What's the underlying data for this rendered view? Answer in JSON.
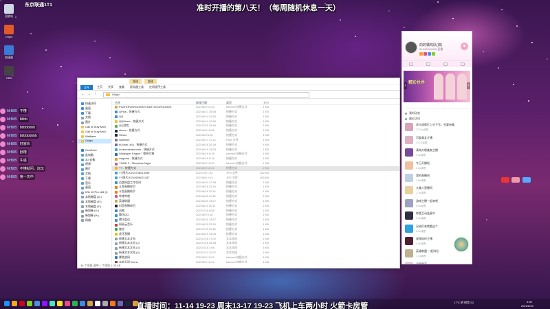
{
  "overlay": {
    "stream_title": "准时开播的第八天！（每周随机休息一天）",
    "stream_schedule": "直播时间：11-14 19-23 周末13-17 19-23 飞机上车两小时 火箭卡房管",
    "brand": "东京联通1T1"
  },
  "desktop_icons": [
    {
      "label": "回收站",
      "icon": "recycle-bin-icon",
      "color": "#cfd8e6"
    },
    {
      "label": "Origin",
      "icon": "origin-icon",
      "color": "#e05a2b"
    },
    {
      "label": "加速器",
      "icon": "accelerator-icon",
      "color": "#3a7bd5"
    },
    {
      "label": "OBS",
      "icon": "obs-icon",
      "color": "#444"
    }
  ],
  "chat": [
    {
      "user": "MrB85",
      "msg": "不懂"
    },
    {
      "user": "MrB85",
      "msg": "bbbb"
    },
    {
      "user": "MrB85",
      "msg": "bbbbbbbb"
    },
    {
      "user": "MrB85",
      "msg": "bbbbbbbbb"
    },
    {
      "user": "MrB85",
      "msg": "好家伙"
    },
    {
      "user": "MrB85",
      "msg": "卧槽"
    },
    {
      "user": "MrB85",
      "msg": "牛逼"
    },
    {
      "user": "MrB85",
      "msg": "不懂就问，这玩"
    },
    {
      "user": "MrB85",
      "msg": "第一次中"
    }
  ],
  "explorer": {
    "title_tabs": [
      "管理",
      "管理"
    ],
    "ribbon_tabs": [
      "文件",
      "主页",
      "共享",
      "查看",
      "驱动器工具",
      "应用程序工具"
    ],
    "address": "Origin",
    "columns": {
      "name": "名称",
      "date": "修改日期",
      "type": "类型",
      "size": "大小"
    },
    "nav": [
      {
        "label": "快速访问",
        "color": "#3d8fe0"
      },
      {
        "label": "桌面",
        "color": "#3d8fe0"
      },
      {
        "label": "下载",
        "color": "#3d8fe0"
      },
      {
        "label": "文档",
        "color": "#8aa0b8"
      },
      {
        "label": "图片",
        "color": "#8aa0b8"
      },
      {
        "label": "Call of Duty  Mod",
        "color": "#f2c24b"
      },
      {
        "label": "Call of Duty  Mod",
        "color": "#f2c24b"
      },
      {
        "label": "Wallhere",
        "color": "#f2c24b"
      },
      {
        "label": "Origin",
        "color": "#f2c24b"
      },
      {
        "label": "",
        "color": "transparent"
      },
      {
        "label": "OneDrive",
        "color": "#2f7fd8"
      },
      {
        "label": "此电脑",
        "color": "#5aa0e0"
      },
      {
        "label": "3D 对象",
        "color": "#5aa0e0"
      },
      {
        "label": "视频",
        "color": "#5aa0e0"
      },
      {
        "label": "图片",
        "color": "#5aa0e0"
      },
      {
        "label": "文档",
        "color": "#5aa0e0"
      },
      {
        "label": "下载",
        "color": "#5aa0e0"
      },
      {
        "label": "音乐",
        "color": "#5aa0e0"
      },
      {
        "label": "桌面",
        "color": "#5aa0e0"
      },
      {
        "label": "Win 10 Pro x64 (C",
        "color": "#8aa0b8"
      },
      {
        "label": "本地磁盘 (D:)",
        "color": "#8aa0b8"
      },
      {
        "label": "本地磁盘 (E:)",
        "color": "#8aa0b8"
      },
      {
        "label": "本地磁盘 (F:)",
        "color": "#8aa0b8"
      },
      {
        "label": "新加卷 (G:)",
        "color": "#8aa0b8"
      },
      {
        "label": "新加卷 (H:)",
        "color": "#8aa0b8"
      },
      {
        "label": "网络",
        "color": "#8aa0b8"
      }
    ],
    "files": [
      {
        "name": "PLAYERUNKNOWN'S BATTLEGROUNDS",
        "date": "2021/6/9 15:24",
        "type": "Internet 快捷方式",
        "size": "1 KB",
        "color": "#d9a33a"
      },
      {
        "name": "QPlus - 快捷方式",
        "date": "2021/6/17 19:08",
        "type": "快捷方式",
        "size": "1 KB",
        "color": "#3a8fd9"
      },
      {
        "name": "QQ",
        "date": "2021/6/14 10:18",
        "type": "快捷方式",
        "size": "1 KB",
        "color": "#3a8fd9"
      },
      {
        "name": "QQMusic - 快捷方式",
        "date": "2021/6/14 10:18",
        "type": "快捷方式",
        "size": "1 KB",
        "color": "#f1c232"
      },
      {
        "name": "QQ游戏",
        "date": "2021/7/21 19:45",
        "type": "快捷方式",
        "size": "1 KB",
        "color": "#5ab04a"
      },
      {
        "name": "steam - 快捷方式",
        "date": "2021/4/9 18:08",
        "type": "快捷方式",
        "size": "1 KB",
        "color": "#1b2838"
      },
      {
        "name": "Steam",
        "date": "2021/6/9 8:16",
        "type": "快捷方式",
        "size": "1 KB",
        "color": "#1b2838"
      },
      {
        "name": "Wallhere",
        "date": "2021/4/17 17:41",
        "type": "PNG 文件",
        "size": "1 KB",
        "color": "#7a7a7a"
      },
      {
        "name": "tx2dark_x64 - 快捷方式",
        "date": "2021/6/16 20:28",
        "type": "快捷方式",
        "size": "1 KB",
        "color": "#6a6aaa"
      },
      {
        "name": "uuremotelauncher - 快捷方式",
        "date": "2021/6/19 13:05",
        "type": "快捷方式",
        "size": "1 KB",
        "color": "#4aa3df"
      },
      {
        "name": "Wallpaper Engine：壁纸引擎",
        "date": "2021/6/19 8:18",
        "type": "Internet 快捷方式",
        "size": "1 KB",
        "color": "#2a66b8"
      },
      {
        "name": "wegame - 快捷方式",
        "date": "2021/6/19 0:18",
        "type": "快捷方式",
        "size": "1 KB",
        "color": "#e0a030"
      },
      {
        "name": "YUME 2 - Sleepless Night",
        "date": "2021/6/9 15:24",
        "type": "Internet 快捷方式",
        "size": "1 KB",
        "color": "#c05aa0"
      },
      {
        "name": "YY - 快捷方式",
        "date": "2021/6/9 15:11",
        "type": "快捷方式",
        "size": "2 KB",
        "color": "#f2b600",
        "selected": true
      },
      {
        "name": "YY图片20210708013449",
        "date": "2021/7/8 1:34",
        "type": "JPG 文件",
        "size": "342 KB",
        "color": "#3aa0e0"
      },
      {
        "name": "YY图片20210606021437",
        "date": "2021/6/6 2:14",
        "type": "JPG 文件",
        "size": "193 KB",
        "color": "#3aa0e0"
      },
      {
        "name": "百度网盘工作空间",
        "date": "2021/6/10 17:38",
        "type": "快捷方式",
        "size": "1 KB",
        "color": "#3a8fd9"
      },
      {
        "name": "斗鱼直播伴侣",
        "date": "2021/6/15 22:19",
        "type": "快捷方式",
        "size": "1 KB",
        "color": "#f07a1a"
      },
      {
        "name": "斗鱼直播助手",
        "date": "2021/6/15 22:41",
        "type": "快捷方式",
        "size": "1 KB",
        "color": "#f07a1a"
      },
      {
        "name": "哔哩哔哩",
        "date": "2021/6/22 11:45",
        "type": "快捷方式",
        "size": "1 KB",
        "color": "#e84a8a"
      },
      {
        "name": "英雄联盟",
        "date": "2021/6/20 13:07",
        "type": "快捷方式",
        "size": "1 KB",
        "color": "#c9a84a"
      },
      {
        "name": "抖音直播伴侣",
        "date": "2021/6/10 20:11",
        "type": "快捷方式",
        "size": "1 KB",
        "color": "#222"
      },
      {
        "name": "迅雷",
        "date": "2021/7/18 8:58",
        "type": "快捷方式",
        "size": "1 KB",
        "color": "#3a7fe0"
      },
      {
        "name": "腾讯QQ",
        "date": "2021/6/9 0:18",
        "type": "快捷方式",
        "size": "1 KB",
        "color": "#3a8fd9"
      },
      {
        "name": "腾讯会议",
        "date": "2021/6/21 13:07",
        "type": "快捷方式",
        "size": "1 KB",
        "color": "#3a8fd9"
      },
      {
        "name": "网易云音乐",
        "date": "2021/6/15 22:19",
        "type": "快捷方式",
        "size": "1 KB",
        "color": "#d33a3a"
      },
      {
        "name": "微信",
        "date": "2021/7/11 21:38",
        "type": "快捷方式",
        "size": "1 KB",
        "color": "#2bb24c"
      },
      {
        "name": "虎牙直播",
        "date": "2021/6/19 13:03",
        "type": "快捷方式",
        "size": "1 KB",
        "color": "#f2b600"
      },
      {
        "name": "新建文本文档",
        "date": "2021/7/18 17:02",
        "type": "文本文档",
        "size": "1 KB",
        "color": "#8aa0b8"
      },
      {
        "name": "新建文本文档 (2)",
        "date": "2021/7/18 16:38",
        "type": "文本文档",
        "size": "1 KB",
        "color": "#8aa0b8"
      },
      {
        "name": "新建文本文档 (3)",
        "date": "2021/7/15 1:08",
        "type": "文本文档",
        "size": "1 KB",
        "color": "#8aa0b8"
      },
      {
        "name": "新建文本文档 (4)",
        "date": "2021/7/12 10:37",
        "type": "文本文档",
        "size": "1 KB",
        "color": "#8aa0b8"
      },
      {
        "name": "暴雪战网",
        "date": "2021/6/9 15:24",
        "type": "Internet 快捷方式",
        "size": "1 KB",
        "color": "#2a7fd0"
      },
      {
        "name": "永劫无间 Demo",
        "date": "2021/6/9 15:24",
        "type": "Internet 快捷方式",
        "size": "1 KB",
        "color": "#a03a3a"
      },
      {
        "name": "永劫无间",
        "date": "2021/7/8 8:22",
        "type": "快捷方式",
        "size": "1 KB",
        "color": "#a03a3a"
      },
      {
        "name": "原神",
        "date": "2021/7/28 0:09",
        "type": "快捷方式",
        "size": "1 KB",
        "color": "#7ab0e0"
      }
    ],
    "status": "36 个项目   选中 1 个项目  1.33 KB"
  },
  "panel": {
    "name": "的的橘鸡队(双)",
    "sub": "ID:990240945 直播",
    "banner_text": "精彩世界",
    "section_rows": [
      "我的动态",
      "最近访问"
    ],
    "feed": [
      {
        "title": "求大佬帮忙上分下号，先要有事",
        "meta": "273.6w观看",
        "color": "#d9a3b8"
      },
      {
        "title": "可爱美女主播",
        "meta": "12.1w观看",
        "color": "#e0b0c0"
      },
      {
        "title": "清纯大眼美女主播",
        "meta": "9.3w观看",
        "color": "#7a4a9a"
      },
      {
        "title": "今日开播啦",
        "meta": "5.2w观看",
        "color": "#f0c0a0"
      },
      {
        "title": "我的直播间",
        "meta": "2.8w观看",
        "color": "#c0d0e0"
      },
      {
        "title": "大美人直播间",
        "meta": "1.7w观看",
        "color": "#e8d0a0"
      },
      {
        "title": "游戏主播一起来吧",
        "meta": "8.4w观看",
        "color": "#a0a0c0"
      },
      {
        "title": "惊喜互动连麦中",
        "meta": "3.6w观看",
        "color": "#303040"
      },
      {
        "title": "兄弟们来看看这个",
        "meta": "6.1w观看",
        "color": "#30a0e0"
      },
      {
        "title": "深夜陪伴主播",
        "meta": "4.9w观看",
        "color": "#502030"
      },
      {
        "title": "英雄联盟 一起排位",
        "meta": "7.7w观看",
        "color": "#c0b090"
      },
      {
        "title": "温暖歌声",
        "meta": "2.2w观看",
        "color": "#e0c0d0"
      }
    ]
  },
  "taskbar": {
    "tray_text": "17°C 阴  拼音 S2",
    "clock_time": "4:55",
    "clock_date": "2021/8/20",
    "icons": [
      "#1e90ff",
      "#f5a623",
      "#d0021b",
      "#7ed321",
      "#4a90e2",
      "#9013fe",
      "#50e3c2",
      "#f8e71c",
      "#e84a8a",
      "#2bb24c",
      "#3a8fd9",
      "#c9a84a",
      "#ffffff",
      "#aaaaaa",
      "#f07a1a",
      "#6a6aaa",
      "#1b2838",
      "#e0a030"
    ]
  }
}
